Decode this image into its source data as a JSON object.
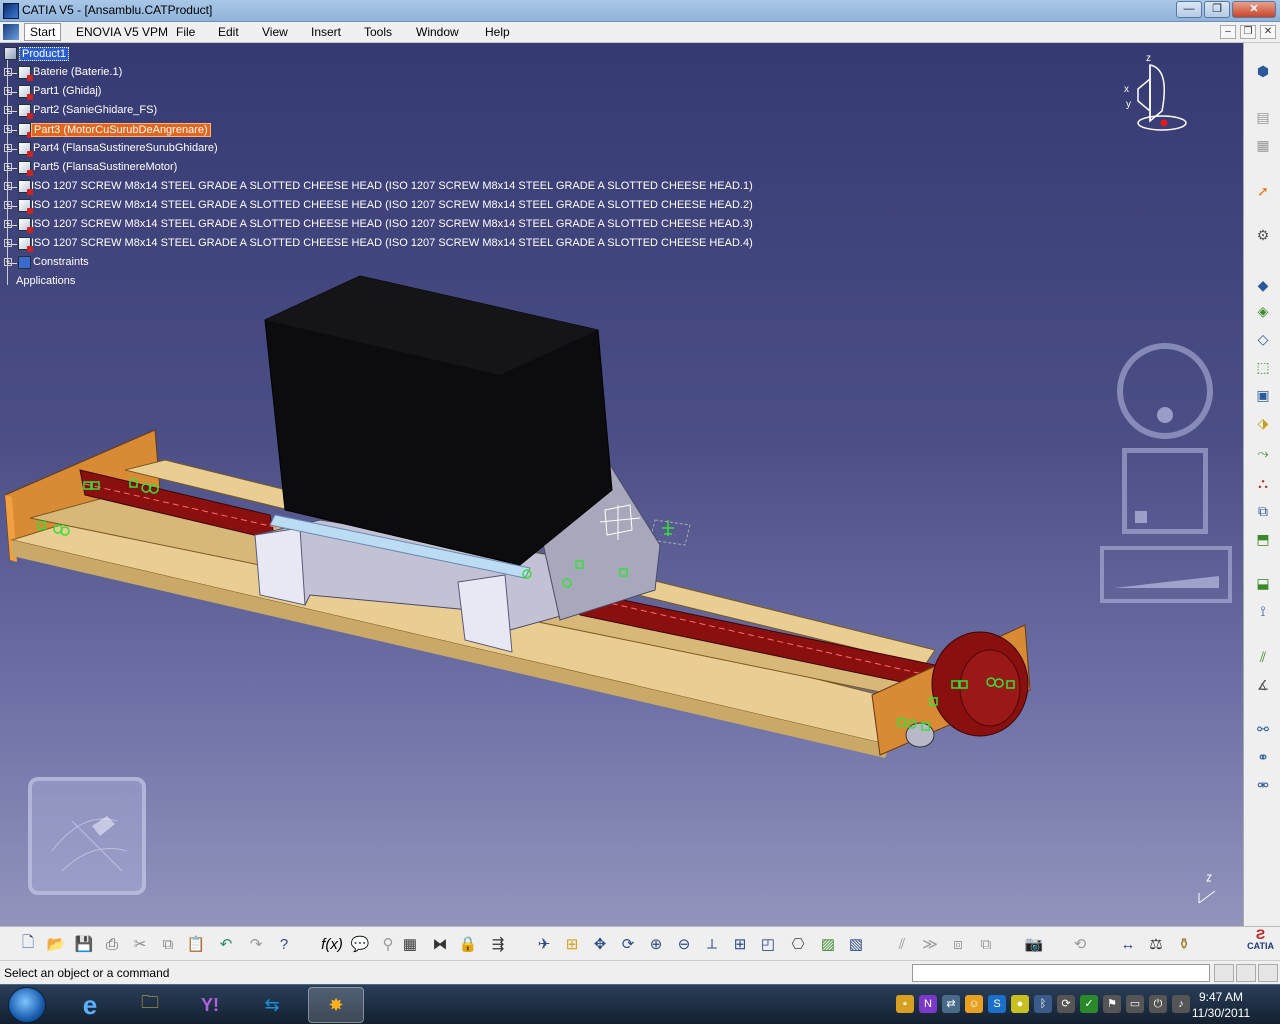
{
  "window": {
    "title": "CATIA V5 - [Ansamblu.CATProduct]",
    "minimize": "—",
    "restore": "❐",
    "close": "✕"
  },
  "menu": {
    "items": [
      "Start",
      "ENOVIA V5 VPM",
      "File",
      "Edit",
      "View",
      "Insert",
      "Tools",
      "Window",
      "Help"
    ],
    "mdi_min": "–",
    "mdi_restore": "❐",
    "mdi_close": "✕"
  },
  "tree": {
    "root": "Product1",
    "nodes": [
      "Baterie (Baterie.1)",
      "Part1 (Ghidaj)",
      "Part2 (SanieGhidare_FS)",
      "Part3 (MotorCuSurubDeAngrenare)",
      "Part4 (FlansaSustinereSurubGhidare)",
      "Part5 (FlansaSustinereMotor)",
      "ISO 1207 SCREW M8x14 STEEL GRADE A SLOTTED CHEESE HEAD (ISO 1207 SCREW M8x14 STEEL GRADE A SLOTTED CHEESE HEAD.1)",
      "ISO 1207 SCREW M8x14 STEEL GRADE A SLOTTED CHEESE HEAD (ISO 1207 SCREW M8x14 STEEL GRADE A SLOTTED CHEESE HEAD.2)",
      "ISO 1207 SCREW M8x14 STEEL GRADE A SLOTTED CHEESE HEAD (ISO 1207 SCREW M8x14 STEEL GRADE A SLOTTED CHEESE HEAD.3)",
      "ISO 1207 SCREW M8x14 STEEL GRADE A SLOTTED CHEESE HEAD (ISO 1207 SCREW M8x14 STEEL GRADE A SLOTTED CHEESE HEAD.4)",
      "Constraints"
    ],
    "applications": "Applications",
    "selected_node": "Part3 (MotorCuSurubDeAngrenare)"
  },
  "compass": {
    "x": "x",
    "y": "y",
    "z": "z"
  },
  "status": {
    "message": "Select an object or a command"
  },
  "taskbar": {
    "time": "9:47 AM",
    "date": "11/30/2011"
  },
  "catia_logo": "CATIA",
  "colors": {
    "viewport_top": "#363a72",
    "viewport_bottom": "#9294bd",
    "selection": "#e2661d",
    "rail_wood": "#e8c98e",
    "screw_red": "#8a1010",
    "battery_black": "#0a0a0a",
    "carriage_grey": "#c2c2d4"
  },
  "icons": {
    "right_toolbar": [
      "compass-icon",
      "catalog-icon",
      "catalog-icon",
      "select-icon",
      "update-icon",
      "assembly-icon",
      "new-part-icon",
      "existing-component-icon",
      "replace-icon",
      "graph-tree-icon",
      "manipulation-icon",
      "snap-icon",
      "explode-icon",
      "stop-clash-icon",
      "fix-icon",
      "coincidence-icon",
      "contact-icon",
      "offset-icon",
      "angle-icon",
      "fix-together-icon",
      "smart-constraint-icon",
      "reuse-pattern-icon"
    ],
    "bottom_toolbar": [
      "new-icon",
      "open-icon",
      "save-icon",
      "print-icon",
      "cut-icon",
      "copy-icon",
      "paste-icon",
      "undo-icon",
      "redo-icon",
      "whats-this-icon",
      "formula-icon",
      "comment-icon",
      "knowledge-icon",
      "table-icon",
      "graph-icon",
      "lock-icon",
      "measure-icon",
      "fly-icon",
      "fit-all-icon",
      "pan-icon",
      "rotate-icon",
      "zoom-in-icon",
      "zoom-out-icon",
      "normal-view-icon",
      "multi-view-icon",
      "iso-view-icon",
      "hide-show-icon",
      "shading-icon",
      "render-icon",
      "catalog-browser-icon",
      "camera-icon",
      "swap-icon",
      "distance-icon",
      "section-icon",
      "clash-icon"
    ]
  }
}
